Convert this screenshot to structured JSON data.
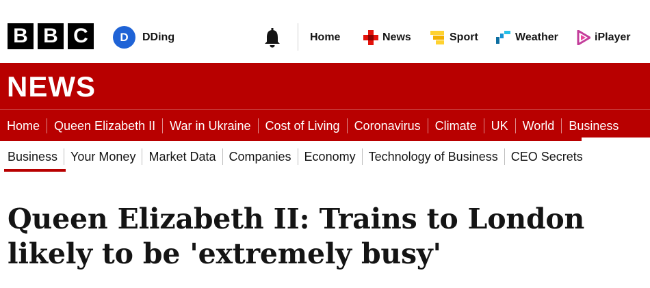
{
  "header": {
    "brand": [
      "B",
      "B",
      "C"
    ],
    "account": {
      "initial": "D",
      "name": "DDing"
    },
    "notifications_icon": "bell-icon",
    "nav": [
      {
        "label": "Home",
        "icon": null
      },
      {
        "label": "News",
        "icon": "news-icon",
        "color": "#e3120b"
      },
      {
        "label": "Sport",
        "icon": "sport-icon",
        "color": "#ffd230"
      },
      {
        "label": "Weather",
        "icon": "weather-icon",
        "color": "#0c6ea1"
      },
      {
        "label": "iPlayer",
        "icon": "iplayer-icon",
        "color": "#c33e9b"
      }
    ]
  },
  "section": {
    "title": "NEWS",
    "color": "#b80000",
    "primary_nav": [
      "Home",
      "Queen Elizabeth II",
      "War in Ukraine",
      "Cost of Living",
      "Coronavirus",
      "Climate",
      "UK",
      "World",
      "Business"
    ],
    "primary_active": "Business",
    "secondary_nav": [
      "Business",
      "Your Money",
      "Market Data",
      "Companies",
      "Economy",
      "Technology of Business",
      "CEO Secrets"
    ],
    "secondary_active": "Business"
  },
  "article": {
    "headline_line1": "Queen Elizabeth II: Trains to London",
    "headline_line2": "likely to be 'extremely busy'"
  }
}
